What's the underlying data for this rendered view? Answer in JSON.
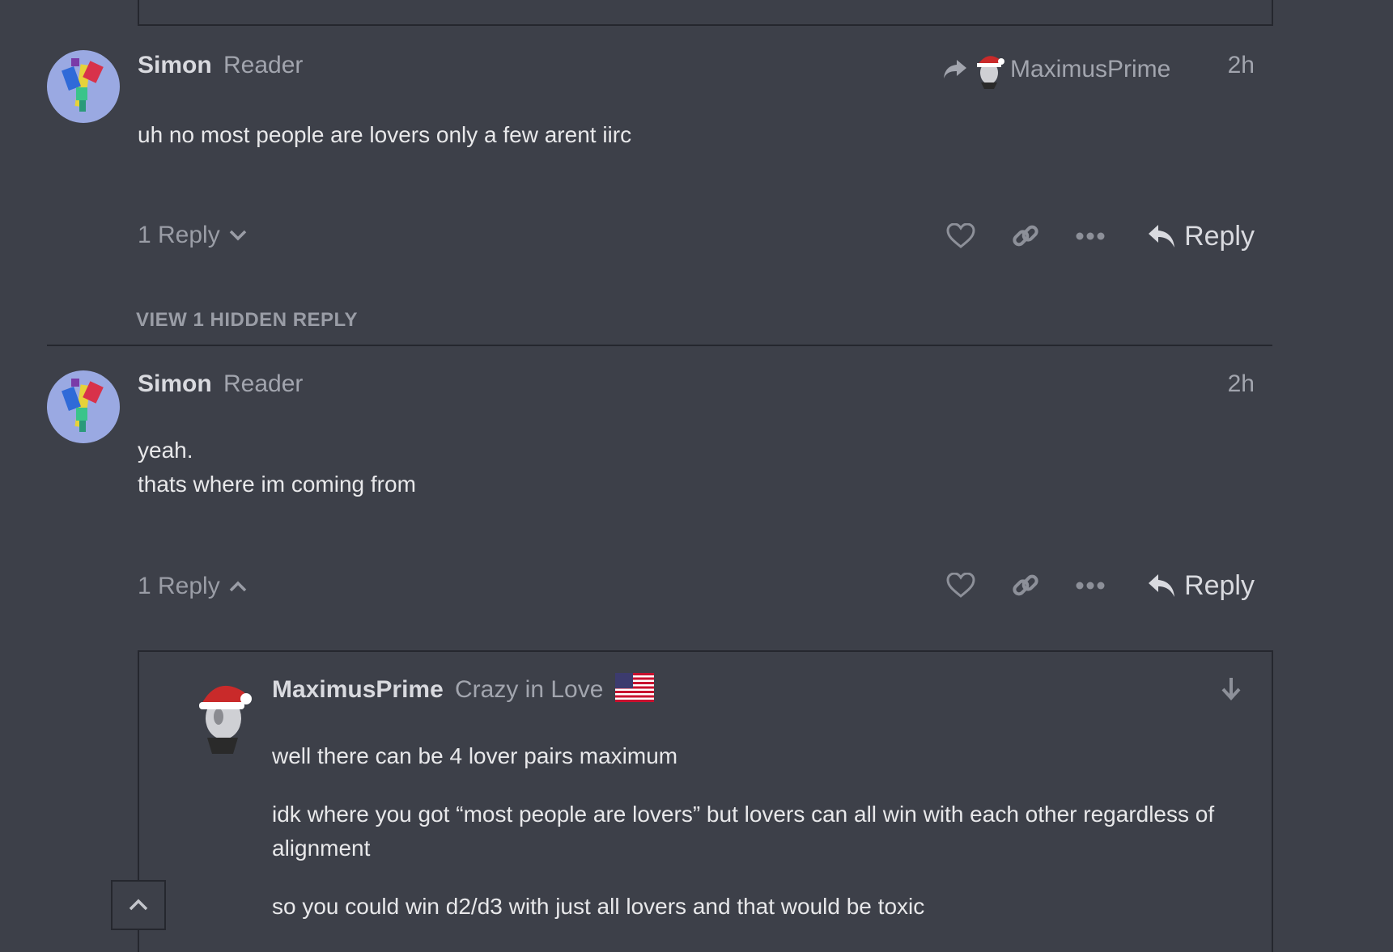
{
  "posts": [
    {
      "username": "Simon",
      "user_title": "Reader",
      "reply_to": "MaximusPrime",
      "time": "2h",
      "body": [
        "uh no most people are lovers only a few arent iirc"
      ],
      "replies_label": "1 Reply",
      "reply_button": "Reply"
    },
    {
      "username": "Simon",
      "user_title": "Reader",
      "time": "2h",
      "body": [
        "yeah.",
        "thats where im coming from"
      ],
      "replies_label": "1 Reply",
      "reply_button": "Reply"
    }
  ],
  "hidden_replies_label": "VIEW 1 HIDDEN REPLY",
  "embedded_reply": {
    "username": "MaximusPrime",
    "user_title": "Crazy in Love",
    "body": [
      "well there can be 4 lover pairs maximum",
      "idk where you got “most people are lovers” but lovers can all win with each other regardless of alignment",
      "so you could win d2/d3 with just all lovers and that would be toxic"
    ]
  },
  "icons": {
    "share": "share-arrow-icon",
    "like": "heart-icon",
    "link": "link-icon",
    "more": "ellipsis-icon",
    "reply": "reply-arrow-icon",
    "expand": "chevron-down-icon",
    "collapse": "chevron-up-icon",
    "jump": "arrow-down-icon",
    "scroll_top": "chevron-up-icon",
    "flag": "us-flag-icon"
  },
  "colors": {
    "background": "#3d4049",
    "border": "#25272e",
    "text": "#e8e8ea",
    "muted": "#a2a5ae",
    "avatar_bg": "#9aa9e2"
  }
}
